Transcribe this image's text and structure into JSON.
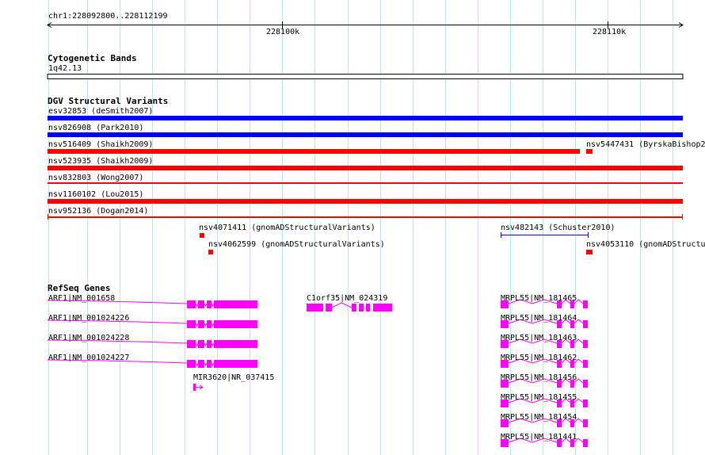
{
  "ruler": {
    "location": "chr1:228092800..228112199",
    "ticks": [
      "228100k",
      "228110k"
    ]
  },
  "tracks": {
    "cytoband": {
      "title": "Cytogenetic Bands",
      "band": "1q42.13"
    },
    "dgv": {
      "title": "DGV Structural Variants",
      "features": [
        {
          "label": "esv32853 (deSmith2007)",
          "color": "#0000ff"
        },
        {
          "label": "nsv826908 (Park2010)",
          "color": "#0000ff"
        },
        {
          "label": "nsv516409 (Shaikh2009)",
          "color": "#ff0000"
        },
        {
          "label": "nsv5447431 (ByrskaBishop2",
          "color": "#ff0000"
        },
        {
          "label": "nsv523935 (Shaikh2009)",
          "color": "#ff0000"
        },
        {
          "label": "nsv832803 (Wong2007)",
          "color": "#ff0000"
        },
        {
          "label": "nsv1160102 (Lou2015)",
          "color": "#ff0000"
        },
        {
          "label": "nsv952136 (Dogan2014)",
          "color": "#ff0000"
        },
        {
          "label": "nsv4071411 (gnomADStructuralVariants)",
          "color": "#ff0000"
        },
        {
          "label": "nsv482143 (Schuster2010)",
          "color": "#0000ff"
        },
        {
          "label": "nsv4062599 (gnomADStructuralVariants)",
          "color": "#ff0000"
        },
        {
          "label": "nsv4053110 (gnomADStructu",
          "color": "#ff0000"
        }
      ]
    },
    "refseq": {
      "title": "RefSeq Genes",
      "color": "#ff00ff",
      "genes": [
        "ARF1|NM_001658",
        "ARF1|NM_001024226",
        "ARF1|NM_001024228",
        "ARF1|NM_001024227",
        "MIR3620|NR_037415",
        "C1orf35|NM_024319",
        "MRPL55|NM_181465",
        "MRPL55|NM_181464",
        "MRPL55|NM_181463",
        "MRPL55|NM_181462",
        "MRPL55|NM_181456",
        "MRPL55|NM_181455",
        "MRPL55|NM_181454",
        "MRPL55|NM_181441"
      ]
    }
  }
}
